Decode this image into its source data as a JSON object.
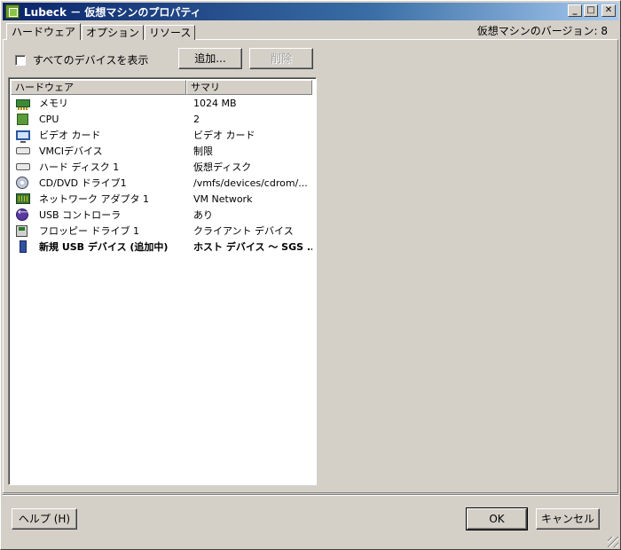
{
  "window": {
    "title": "Lubeck － 仮想マシンのプロパティ",
    "minimize": "_",
    "maximize": "□",
    "close": "✕"
  },
  "tabs": [
    {
      "label": "ハードウェア",
      "active": true
    },
    {
      "label": "オプション",
      "active": false
    },
    {
      "label": "リソース",
      "active": false
    }
  ],
  "vm_version": "仮想マシンのバージョン: 8",
  "show_all_devices": {
    "label": "すべてのデバイスを表示",
    "checked": false
  },
  "buttons": {
    "add": "追加...",
    "remove": "削除",
    "help": "ヘルプ (H)",
    "ok": "OK",
    "cancel": "キャンセル"
  },
  "hardware_list": {
    "columns": [
      "ハードウェア",
      "サマリ"
    ],
    "rows": [
      {
        "icon": "memory-icon",
        "name": "メモリ",
        "summary": "1024 MB",
        "bold": false
      },
      {
        "icon": "cpu-icon",
        "name": "CPU",
        "summary": "2",
        "bold": false
      },
      {
        "icon": "video-card-icon",
        "name": "ビデオ カード",
        "summary": "ビデオ カード",
        "bold": false
      },
      {
        "icon": "vmci-device-icon",
        "name": "VMCIデバイス",
        "summary": "制限",
        "bold": false
      },
      {
        "icon": "hard-disk-icon",
        "name": "ハード ディスク 1",
        "summary": "仮想ディスク",
        "bold": false
      },
      {
        "icon": "cd-dvd-icon",
        "name": "CD/DVD ドライブ1",
        "summary": "/vmfs/devices/cdrom/...",
        "bold": false
      },
      {
        "icon": "network-adapter-icon",
        "name": "ネットワーク アダプタ 1",
        "summary": "VM Network",
        "bold": false
      },
      {
        "icon": "usb-controller-icon",
        "name": "USB コントローラ",
        "summary": "あり",
        "bold": false
      },
      {
        "icon": "floppy-drive-icon",
        "name": "フロッピー ドライブ 1",
        "summary": "クライアント デバイス",
        "bold": false
      },
      {
        "icon": "usb-device-icon",
        "name": "新規 USB デバイス (追加中)",
        "summary": "ホスト デバイス 〜 SGS ...",
        "bold": true
      }
    ]
  }
}
